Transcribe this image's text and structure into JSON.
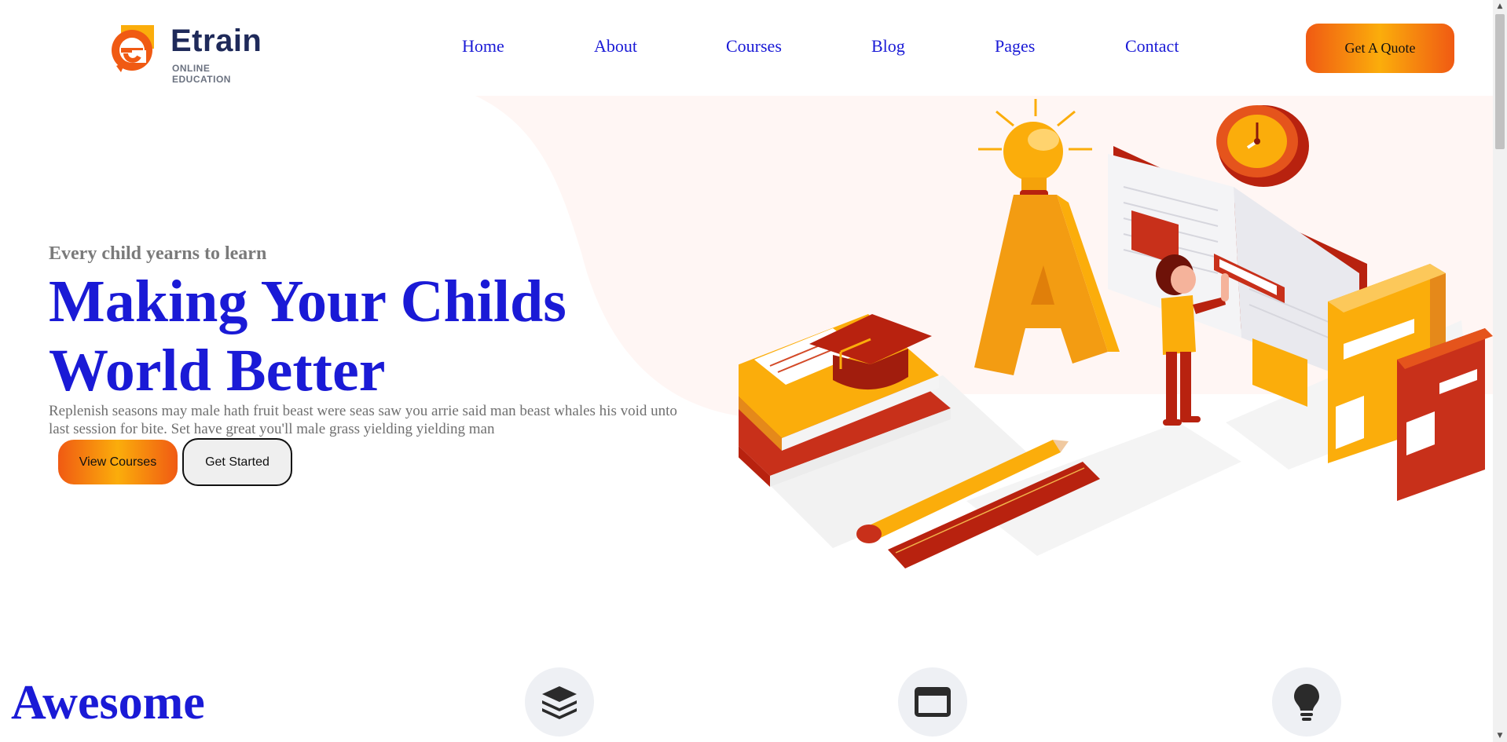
{
  "header": {
    "logo": {
      "name": "Etrain",
      "tagline": "ONLINE EDUCATION"
    },
    "nav": [
      {
        "label": "Home"
      },
      {
        "label": "About"
      },
      {
        "label": "Courses"
      },
      {
        "label": "Blog"
      },
      {
        "label": "Pages"
      },
      {
        "label": "Contact"
      }
    ],
    "cta_label": "Get A Quote"
  },
  "hero": {
    "eyebrow": "Every child yearns to learn",
    "title": "Making Your Childs World Better",
    "description": "Replenish seasons may male hath fruit beast were seas saw you arrie said man beast whales his void unto last session for bite. Set have great you'll male grass yielding yielding man",
    "primary_button": "View Courses",
    "secondary_button": "Get Started"
  },
  "features": {
    "title": "Awesome",
    "icons": [
      "layers-icon",
      "browser-window-icon",
      "lightbulb-icon"
    ]
  },
  "colors": {
    "accent_orange": "#f05a13",
    "accent_yellow": "#fbad0b",
    "link_blue": "#1a1ad6",
    "hero_bg": "#fff6f4"
  }
}
